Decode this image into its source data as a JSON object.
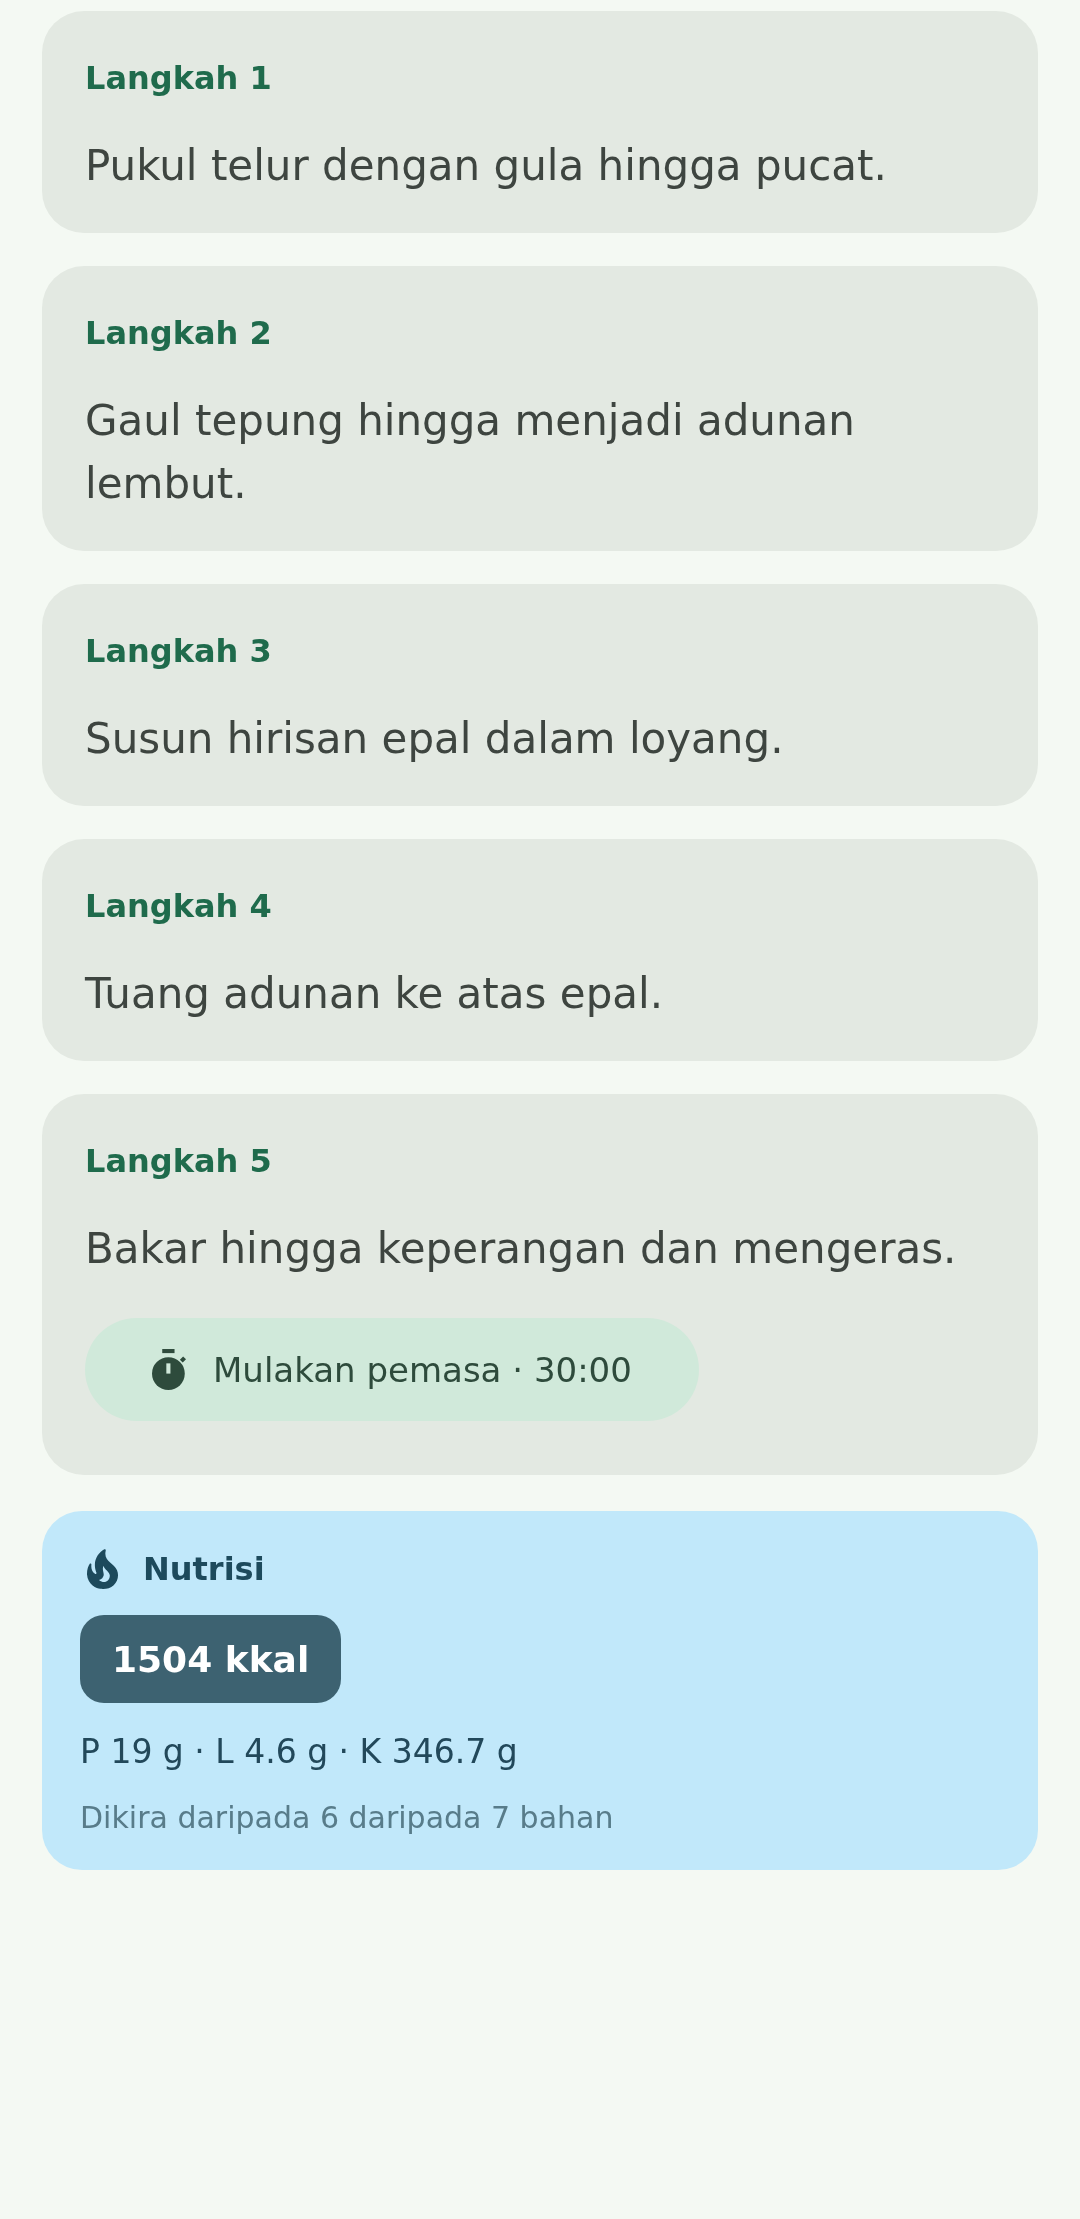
{
  "steps": [
    {
      "label": "Langkah 1",
      "text": "Pukul telur dengan gula hingga pucat."
    },
    {
      "label": "Langkah 2",
      "text": "Gaul tepung hingga menjadi adunan lembut."
    },
    {
      "label": "Langkah 3",
      "text": "Susun hirisan epal dalam loyang."
    },
    {
      "label": "Langkah 4",
      "text": "Tuang adunan ke atas epal."
    },
    {
      "label": "Langkah 5",
      "text": "Bakar hingga keperangan dan mengeras.",
      "timer": {
        "label": "Mulakan pemasa · 30:00"
      }
    }
  ],
  "nutrition": {
    "title": "Nutrisi",
    "calories": "1504 kkal",
    "macros": "P 19 g · L 4.6 g · K 346.7 g",
    "note": "Dikira daripada 6 daripada 7 bahan"
  }
}
